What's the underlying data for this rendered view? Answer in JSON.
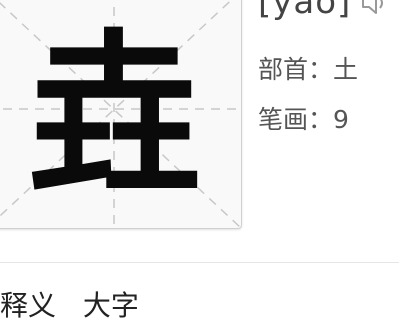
{
  "character": {
    "glyph": "垚",
    "pinyin": "[yáo]",
    "speaker_icon": "speaker-icon"
  },
  "info": {
    "radical_label": "部首：",
    "radical_value": "土",
    "strokes_label": "笔画：",
    "strokes_value": "9"
  },
  "bottom_tabs": [
    "释义",
    "大字"
  ],
  "colors": {
    "card_bg": "#f9f9f9",
    "grid_line": "#c8c8c8",
    "text": "#555555"
  }
}
